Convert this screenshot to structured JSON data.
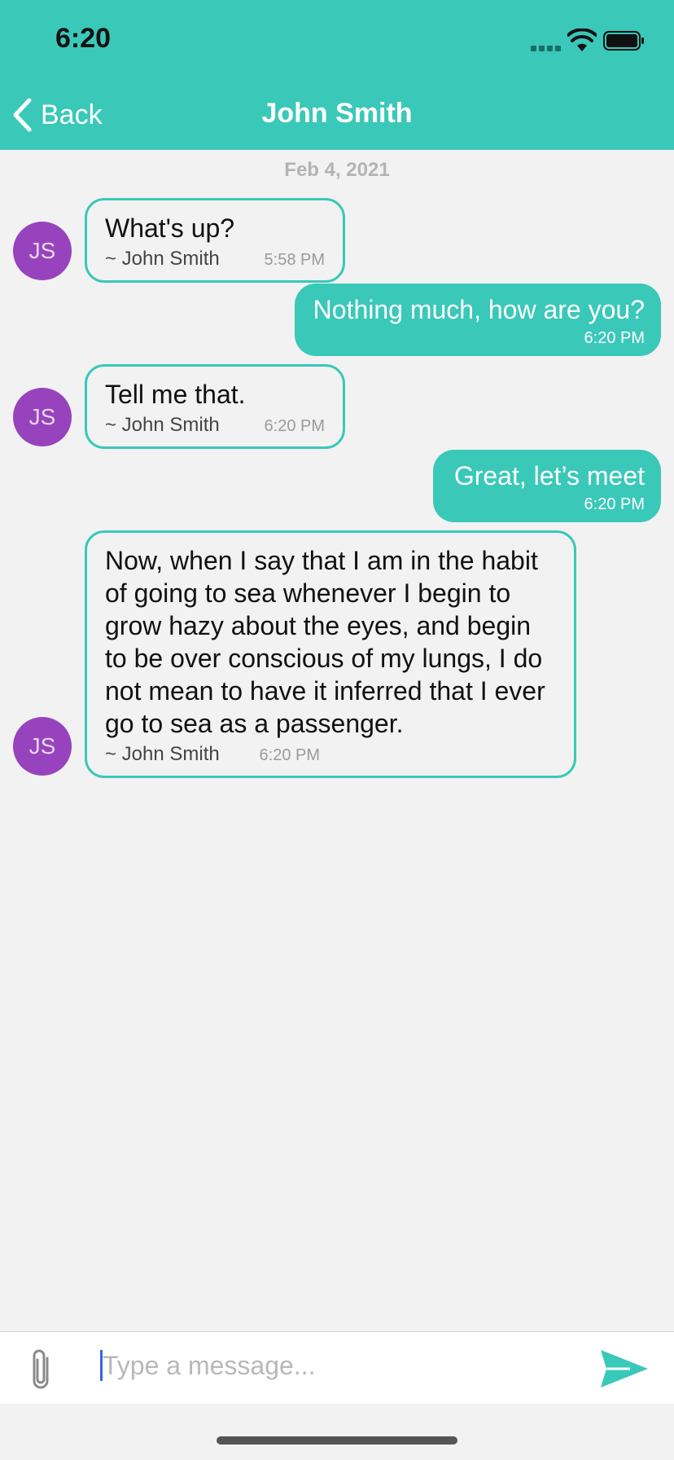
{
  "status_bar": {
    "time": "6:20"
  },
  "nav": {
    "back_label": "Back",
    "title": "John Smith"
  },
  "conversation": {
    "date": "Feb 4, 2021",
    "messages": [
      {
        "direction": "incoming",
        "avatar": "JS",
        "text": "What's up?",
        "sender": "~ John Smith",
        "time": "5:58 PM"
      },
      {
        "direction": "outgoing",
        "text": "Nothing much, how are you?",
        "time": "6:20 PM"
      },
      {
        "direction": "incoming",
        "avatar": "JS",
        "text": "Tell me that.",
        "sender": "~ John Smith",
        "time": "6:20 PM"
      },
      {
        "direction": "outgoing",
        "text": "Great, let’s meet",
        "time": "6:20 PM"
      },
      {
        "direction": "incoming",
        "avatar": "JS",
        "text": "Now, when I say that I am in the habit of going to sea whenever I begin to grow hazy about the eyes, and begin to be over conscious of my lungs, I do not mean to have it inferred that I ever go to sea as a passenger.",
        "sender": "~ John Smith",
        "time": "6:20 PM"
      }
    ]
  },
  "composer": {
    "placeholder": "Type a message...",
    "value": ""
  },
  "icons": {
    "back": "chevron-left-icon",
    "attach": "paperclip-icon",
    "send": "send-icon",
    "wifi": "wifi-icon",
    "battery": "battery-icon"
  },
  "colors": {
    "accent": "#3ac8b9",
    "avatar": "#9643bd",
    "background": "#f2f2f2"
  }
}
